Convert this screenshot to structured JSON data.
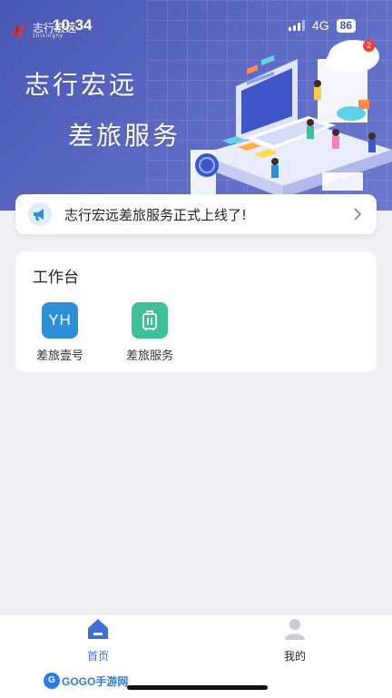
{
  "status_bar": {
    "time": "10:34",
    "network": "4G",
    "battery": "86"
  },
  "hero": {
    "brand_name": "志行宏远",
    "brand_sub": "zhixinghy",
    "title_line1": "志行宏远",
    "title_line2": "差旅服务",
    "message_badge": "2"
  },
  "notice": {
    "text": "志行宏远差旅服务正式上线了!"
  },
  "workbench": {
    "title": "工作台",
    "apps": [
      {
        "label": "差旅壹号",
        "icon_text": "YH",
        "color": "#2d8fd6"
      },
      {
        "label": "差旅服务",
        "color": "#3fbf97"
      }
    ]
  },
  "tabbar": {
    "tabs": [
      {
        "label": "首页",
        "active": true,
        "color": "#3f6fd8"
      },
      {
        "label": "我的",
        "active": false
      }
    ]
  },
  "watermark": {
    "text": "GOGO手游网"
  },
  "colors": {
    "accent": "#4a58b4",
    "tab_active": "#3f6fd8"
  }
}
